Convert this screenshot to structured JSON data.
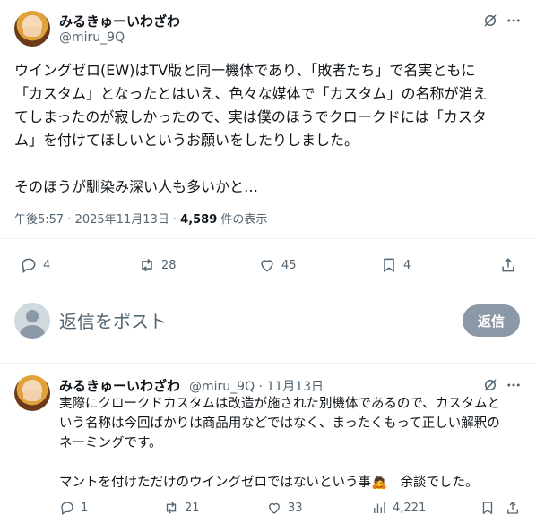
{
  "main_tweet": {
    "author_name": "みるきゅーいわざわ",
    "handle": "@miru_9Q",
    "text": "ウイングゼロ(EW)はTV版と同一機体であり、「敗者たち」で名実ともに\n「カスタム」となったとはいえ、色々な媒体で「カスタム」の名称が消え\nてしまったのが寂しかったので、実は僕のほうでクロークドには「カスタ\nム」を付けてほしいというお願いをしたりしました。\n\nそのほうが馴染み深い人も多いかと…",
    "timestamp": "午後5:57 · 2025年11月13日 · ",
    "views_count": "4,589",
    "views_label": " 件の表示",
    "replies": "4",
    "reposts": "28",
    "likes": "45",
    "bookmarks": "4"
  },
  "composer": {
    "placeholder": "返信をポスト",
    "reply_button": "返信"
  },
  "reply_tweet": {
    "author_name": "みるきゅーいわざわ",
    "handle_date": "@miru_9Q · 11月13日",
    "text": "実際にクロークドカスタムは改造が施された別機体であるので、カスタムと\nいう名称は今回ばかりは商品用などではなく、まったくもって正しい解釈の\nネーミングです。\n\nマントを付けただけのウイングゼロではないという事🙇　余談でした。",
    "replies": "1",
    "reposts": "21",
    "likes": "33",
    "views": "4,221"
  },
  "icons": {
    "grok": "grok-icon",
    "more": "more-icon",
    "reply": "reply-icon",
    "repost": "repost-icon",
    "like": "like-icon",
    "bookmark": "bookmark-icon",
    "share": "share-icon",
    "views": "views-icon"
  }
}
